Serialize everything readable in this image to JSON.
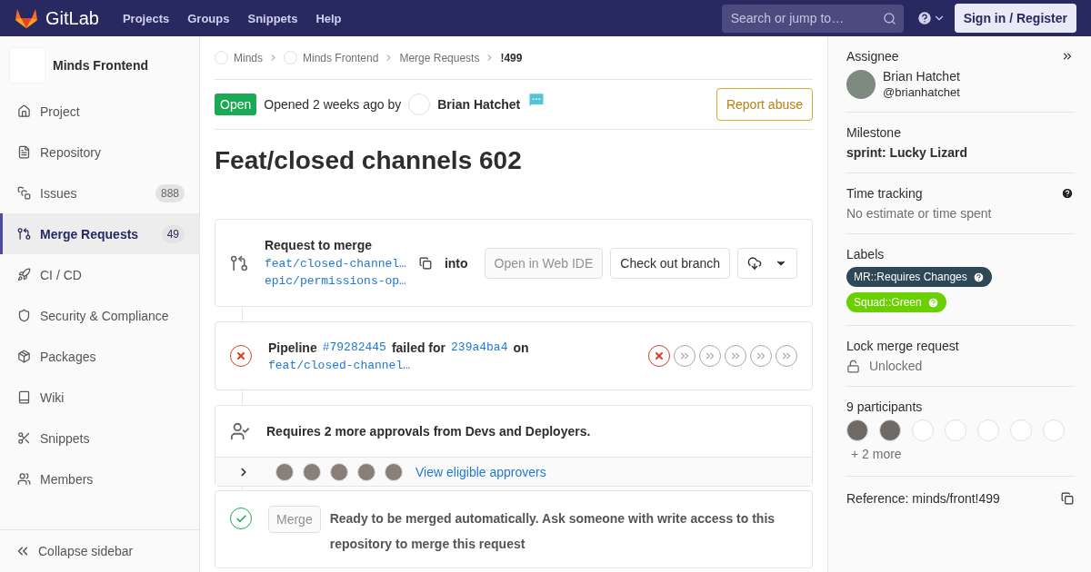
{
  "topbar": {
    "brand": "GitLab",
    "nav": [
      "Projects",
      "Groups",
      "Snippets",
      "Help"
    ],
    "search": {
      "placeholder": "Search or jump to…"
    },
    "sign_in": "Sign in / Register"
  },
  "sidebar": {
    "project": "Minds Frontend",
    "items": [
      {
        "label": "Project",
        "selected": false
      },
      {
        "label": "Repository",
        "selected": false
      },
      {
        "label": "Issues",
        "count": "888",
        "selected": false
      },
      {
        "label": "Merge Requests",
        "count": "49",
        "selected": true
      },
      {
        "label": "CI / CD",
        "selected": false
      },
      {
        "label": "Security & Compliance",
        "selected": false
      },
      {
        "label": "Packages",
        "selected": false
      },
      {
        "label": "Wiki",
        "selected": false
      },
      {
        "label": "Snippets",
        "selected": false
      },
      {
        "label": "Members",
        "selected": false
      }
    ],
    "collapse": "Collapse sidebar"
  },
  "breadcrumbs": [
    {
      "label": "Minds",
      "avatar": true
    },
    {
      "label": "Minds Frontend",
      "avatar": true
    },
    {
      "label": "Merge Requests",
      "avatar": false
    },
    {
      "label": "!499",
      "avatar": false
    }
  ],
  "header": {
    "status": "Open",
    "opened": "Opened 2 weeks ago by",
    "author": "Brian Hatchet",
    "report": "Report abuse"
  },
  "title": "Feat/closed channels 602",
  "merge_request": {
    "heading": "Request to merge",
    "source": "feat/closed-channel…",
    "into": "into",
    "target": "epic/permissions-op…",
    "web_ide": "Open in Web IDE",
    "checkout": "Check out branch"
  },
  "pipeline": {
    "label": "Pipeline",
    "id": "#79282445",
    "failed_for": "failed for",
    "commit": "239a4ba4",
    "on": "on",
    "branch": "feat/closed-channel…",
    "stages": [
      {
        "kind": "failed"
      },
      {
        "kind": "skipped"
      },
      {
        "kind": "skipped"
      },
      {
        "kind": "skipped"
      },
      {
        "kind": "skipped"
      },
      {
        "kind": "skipped"
      }
    ]
  },
  "approvals": {
    "text": "Requires 2 more approvals from Devs and Deployers.",
    "approvers": [
      {
        "kind": "photo"
      },
      {
        "kind": "photo"
      },
      {
        "kind": "photo"
      },
      {
        "kind": "photo"
      },
      {
        "kind": "photo"
      }
    ],
    "link": "View eligible approvers",
    "expanded": false
  },
  "merge": {
    "button": "Merge",
    "text": "Ready to be merged automatically. Ask someone with write access to this repository to merge this request"
  },
  "right": {
    "assignee": {
      "title": "Assignee",
      "name": "Brian Hatchet",
      "handle": "@brianhatchet"
    },
    "milestone": {
      "title": "Milestone",
      "value": "sprint: Lucky Lizard"
    },
    "time": {
      "title": "Time tracking",
      "value": "No estimate or time spent"
    },
    "labels": {
      "title": "Labels",
      "items": [
        {
          "text": "MR::Requires Changes",
          "color": "#2f4858"
        },
        {
          "text": "Squad::Green",
          "color": "#69d100"
        }
      ]
    },
    "lock": {
      "title": "Lock merge request",
      "value": "Unlocked"
    },
    "participants": {
      "title": "9 participants",
      "people": [
        {
          "kind": "photo"
        },
        {
          "kind": "photo"
        },
        {
          "kind": "empty"
        },
        {
          "kind": "empty"
        },
        {
          "kind": "empty"
        },
        {
          "kind": "empty"
        },
        {
          "kind": "empty"
        }
      ],
      "more": "+ 2 more"
    },
    "reference": "Reference: minds/front!499"
  }
}
